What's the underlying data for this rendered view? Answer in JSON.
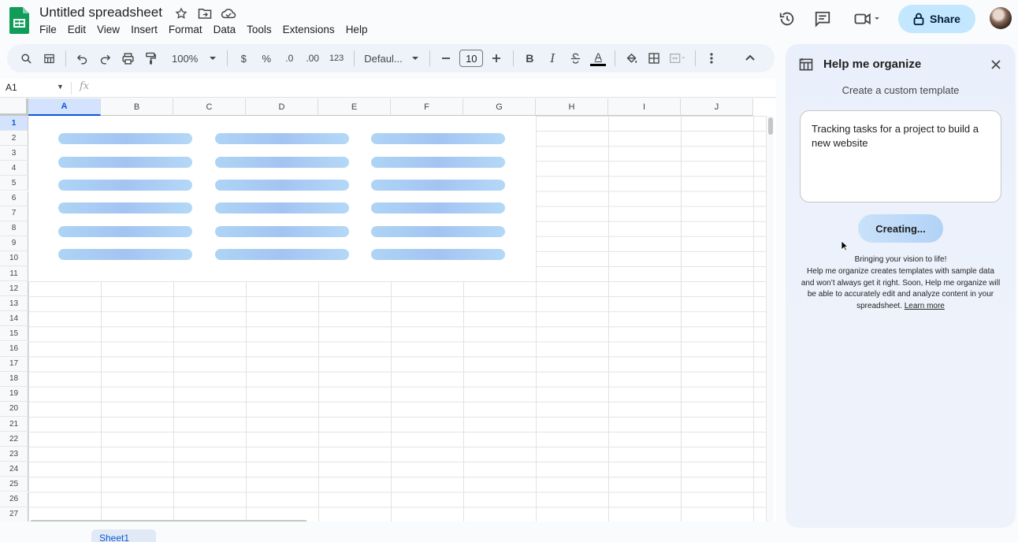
{
  "app": {
    "doc_title": "Untitled spreadsheet",
    "menu": [
      "File",
      "Edit",
      "View",
      "Insert",
      "Format",
      "Data",
      "Tools",
      "Extensions",
      "Help"
    ],
    "share_label": "Share"
  },
  "toolbar": {
    "zoom": "100%",
    "currency": "$",
    "percent": "%",
    "dec_decrease": ".0",
    "dec_increase": ".00",
    "number_format": "123",
    "font": "Defaul...",
    "font_size": "10",
    "bold": "B",
    "italic": "I",
    "text_color": "A"
  },
  "formula_bar": {
    "name_box": "A1",
    "fx": "fx"
  },
  "grid": {
    "columns": [
      "A",
      "B",
      "C",
      "D",
      "E",
      "F",
      "G",
      "H",
      "I",
      "J"
    ],
    "rows": [
      "1",
      "2",
      "3",
      "4",
      "5",
      "6",
      "7",
      "8",
      "9",
      "10",
      "11",
      "12",
      "13",
      "14",
      "15",
      "16",
      "17",
      "18",
      "19",
      "20",
      "21",
      "22",
      "23",
      "24",
      "25",
      "26",
      "27"
    ],
    "selected_cell": "A1"
  },
  "panel": {
    "title": "Help me organize",
    "subtitle": "Create a custom template",
    "prompt_text": "Tracking tasks for a project to build a new website",
    "button_label": "Creating...",
    "note_line1": "Bringing your vision to life!",
    "note_body": "Help me organize creates templates with sample data and won’t always get it right. Soon, Help me organize will be able to accurately edit and analyze content in your spreadsheet.",
    "learn_more": "Learn more"
  },
  "sheets": {
    "active_tab": "Sheet1"
  },
  "colors": {
    "accent": "#0b57d0",
    "share_bg": "#c2e7ff",
    "sheets_green": "#0f9d58"
  }
}
